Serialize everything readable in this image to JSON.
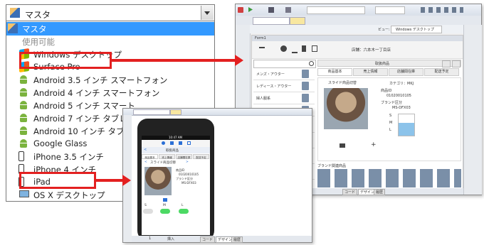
{
  "dropdown": {
    "selected": "マスタ",
    "items": [
      {
        "label": "マスタ",
        "icon": "pencil-icon",
        "type": "selected"
      },
      {
        "label": "使用可能",
        "icon": "",
        "type": "group"
      },
      {
        "label": "Windows デスクトップ",
        "icon": "windows-icon",
        "type": "item"
      },
      {
        "label": "Surface Pro",
        "icon": "windows-icon",
        "type": "item"
      },
      {
        "label": "Android 3.5 インチ スマートフォン",
        "icon": "android-icon",
        "type": "item"
      },
      {
        "label": "Android 4 インチ スマートフォン",
        "icon": "android-icon",
        "type": "item"
      },
      {
        "label": "Android 5 インチ スマート",
        "icon": "android-icon",
        "type": "item"
      },
      {
        "label": "Android 7 インチ タブレッ",
        "icon": "android-icon",
        "type": "item"
      },
      {
        "label": "Android 10 インチ タブレッ",
        "icon": "android-icon",
        "type": "item"
      },
      {
        "label": "Google Glass",
        "icon": "android-icon",
        "type": "item"
      },
      {
        "label": "iPhone 3.5 インチ",
        "icon": "phone-icon",
        "type": "item"
      },
      {
        "label": "iPhone 4 インチ",
        "icon": "phone-icon",
        "type": "item"
      },
      {
        "label": "iPad",
        "icon": "phone-icon",
        "type": "item"
      },
      {
        "label": "OS X デスクトップ",
        "icon": "monitor-icon",
        "type": "item"
      }
    ]
  },
  "windows_shot": {
    "title_tab": "Form1",
    "layout_label": "Windows デスクトップ",
    "store_label": "店舗：六本木一丁目店",
    "menu_items": [
      "メンズ・アウター",
      "レディース・アウター",
      "婦人服系",
      "カジュアル系"
    ],
    "sub_items": [
      "スーツ",
      "コート",
      "ジャケット",
      "パンツ"
    ],
    "tabs": [
      "商品基本",
      "売上情報",
      "店舗間在庫",
      "配送予定"
    ],
    "header_center": "取扱商品",
    "slider_label": "スライド商品切替",
    "category": "カテゴリ：MKJ",
    "code_label": "商品ID",
    "code_value": "01020010105",
    "brand_label": "ブランド区分",
    "brand_value": "MS-DFX03",
    "sizes": [
      "S",
      "M",
      "L"
    ],
    "related_label": "ブランド関連商品",
    "bottom_tabs": [
      "コード",
      "デザイン",
      "履歴"
    ],
    "status_num": "1",
    "status_mode": "挿入"
  },
  "iphone_shot": {
    "time": "10:47 AM",
    "nav_title": "取扱商品",
    "tabs": [
      "商品基本",
      "売上情報",
      "店舗間在庫",
      "配送予定"
    ],
    "slider_label": "スライド商品切替",
    "code_label": "商品ID",
    "code_value": "01020010105",
    "brand_label": "ブランド区分",
    "brand_value": "MS-DFX03",
    "sizes": [
      "S",
      "M",
      "L"
    ],
    "bottom_tabs": [
      "コード",
      "デザイン",
      "履歴"
    ],
    "status_num": "1",
    "status_mode": "挿入"
  },
  "colors": {
    "highlight": "#e32020",
    "selection": "#3399ff",
    "android": "#7bb33e"
  }
}
